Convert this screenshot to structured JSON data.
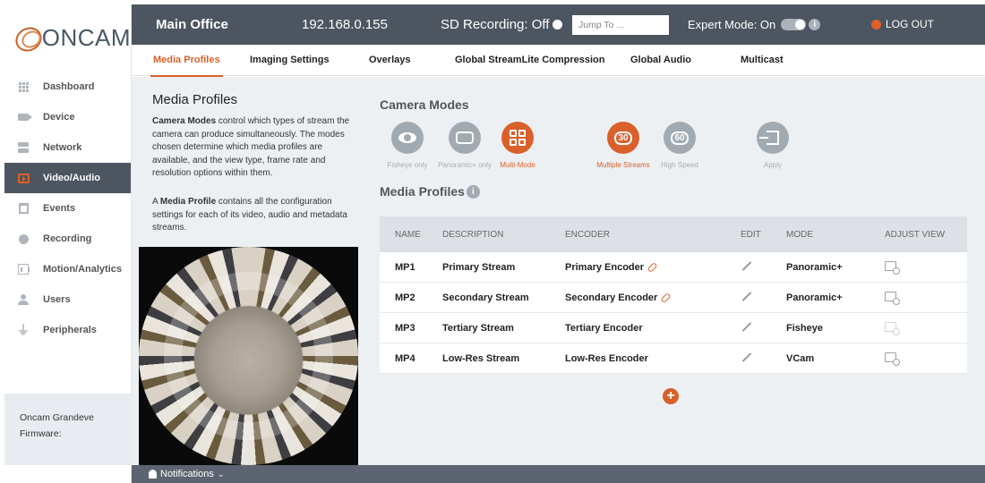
{
  "brand": {
    "logo_text": "ONCAM"
  },
  "sidebar": {
    "items": [
      {
        "label": "Dashboard",
        "icon": "grid-icon"
      },
      {
        "label": "Device",
        "icon": "camera-icon"
      },
      {
        "label": "Network",
        "icon": "network-icon"
      },
      {
        "label": "Video/Audio",
        "icon": "video-icon",
        "active": true
      },
      {
        "label": "Events",
        "icon": "calendar-icon"
      },
      {
        "label": "Recording",
        "icon": "record-icon"
      },
      {
        "label": "Motion/Analytics",
        "icon": "analytics-icon"
      },
      {
        "label": "Users",
        "icon": "user-icon"
      },
      {
        "label": "Peripherals",
        "icon": "usb-icon"
      }
    ],
    "device_name": "Oncam Grandeve",
    "firmware_label": "Firmware:"
  },
  "header": {
    "site_name": "Main Office",
    "ip": "192.168.0.155",
    "sd_recording": "SD Recording: Off",
    "jump_placeholder": "Jump To ...",
    "expert_mode": "Expert Mode: On",
    "logout": "LOG OUT"
  },
  "tabs": [
    {
      "label": "Media Profiles",
      "active": true
    },
    {
      "label": "Imaging Settings"
    },
    {
      "label": "Overlays"
    },
    {
      "label": "Global StreamLite Compression"
    },
    {
      "label": "Global Audio"
    },
    {
      "label": "Multicast"
    }
  ],
  "info": {
    "title": "Media Profiles",
    "p1_bold": "Camera Modes",
    "p1_rest": " control which types of stream the camera can produce simultaneously. The modes chosen determine which media profiles are available, and the view type, frame rate and resolution options within them.",
    "p2_pre": "A ",
    "p2_bold": "Media Profile",
    "p2_rest": " contains all the configuration settings for each of its video, audio and metadata streams."
  },
  "camera_modes": {
    "title": "Camera Modes",
    "modes": [
      {
        "label": "Fisheye only",
        "selected": false
      },
      {
        "label": "Panoramic+ only",
        "selected": false
      },
      {
        "label": "Multi-Mode",
        "selected": true
      },
      {
        "label": "Multiple Streams",
        "selected": true,
        "fps": "30"
      },
      {
        "label": "High Speed",
        "selected": false,
        "fps": "60"
      },
      {
        "label": "Apply",
        "selected": false
      }
    ]
  },
  "media_profiles": {
    "title": "Media Profiles",
    "columns": [
      "NAME",
      "DESCRIPTION",
      "ENCODER",
      "EDIT",
      "MODE",
      "ADJUST VIEW"
    ],
    "rows": [
      {
        "name": "MP1",
        "description": "Primary Stream",
        "encoder": "Primary Encoder",
        "linked": true,
        "mode": "Panoramic+",
        "adjust_enabled": true
      },
      {
        "name": "MP2",
        "description": "Secondary Stream",
        "encoder": "Secondary Encoder",
        "linked": true,
        "mode": "Panoramic+",
        "adjust_enabled": true
      },
      {
        "name": "MP3",
        "description": "Tertiary Stream",
        "encoder": "Tertiary Encoder",
        "linked": false,
        "mode": "Fisheye",
        "adjust_enabled": false
      },
      {
        "name": "MP4",
        "description": "Low-Res Stream",
        "encoder": "Low-Res Encoder",
        "linked": false,
        "mode": "VCam",
        "adjust_enabled": true
      }
    ]
  },
  "notifications": {
    "label": "Notifications"
  },
  "colors": {
    "accent": "#d9602a",
    "header": "#4c5560",
    "panel": "#edf0f3"
  }
}
